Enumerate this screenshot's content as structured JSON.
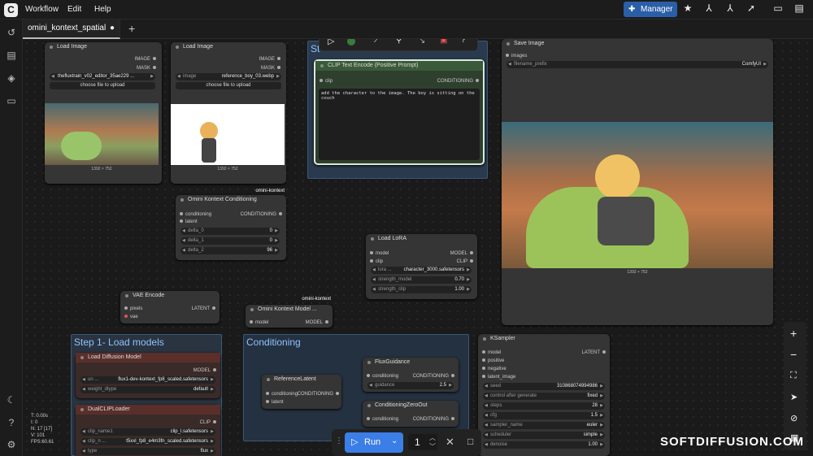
{
  "menu": {
    "items": [
      "Workflow",
      "Edit",
      "Help"
    ],
    "manager": "Manager"
  },
  "tab": {
    "name": "omini_kontext_spatial",
    "dot": "●"
  },
  "stats": {
    "t": "T: 0.00s",
    "i": "I: 0",
    "n": "N: 17 [17]",
    "v": "V: 101",
    "fps": "FPS:60.61"
  },
  "nodes": {
    "load1": {
      "title": "Load Image",
      "out1": "IMAGE",
      "out2": "MASK",
      "file": "thefluxtrain_v02_editor_35ae229 ...",
      "upload": "choose file to upload",
      "dims": "1392 × 752"
    },
    "load2": {
      "title": "Load Image",
      "out1": "IMAGE",
      "out2": "MASK",
      "label": "image",
      "file": "reference_boy_03.webp",
      "upload": "choose file to upload",
      "dims": "1392 × 752",
      "badge": "omini-kontext"
    },
    "clip": {
      "title": "CLIP Text Encode (Positive Prompt)",
      "in": "clip",
      "out": "CONDITIONING",
      "text": "add the character to the image. The boy is sitting on the couch",
      "group_letter": "St"
    },
    "save": {
      "title": "Save Image",
      "in": "images",
      "label": "filename_prefix",
      "value": "ComfyUI",
      "dims": "1392 × 752"
    },
    "okc": {
      "title": "Omini Kontext Conditioning",
      "in1": "conditioning",
      "in2": "latent",
      "out": "CONDITIONING",
      "w": [
        {
          "l": "delta_0",
          "v": "0"
        },
        {
          "l": "delta_1",
          "v": "0"
        },
        {
          "l": "delta_2",
          "v": "96"
        }
      ]
    },
    "lora": {
      "title": "Load LoRA",
      "in1": "model",
      "in2": "clip",
      "out1": "MODEL",
      "out2": "CLIP",
      "w": [
        {
          "l": "lora ...",
          "v": "character_3000.safetensors"
        },
        {
          "l": "strength_model",
          "v": "0.70"
        },
        {
          "l": "strength_clip",
          "v": "1.00"
        }
      ]
    },
    "vae": {
      "title": "VAE Encode",
      "in1": "pixels",
      "in2": "vae",
      "out": "LATENT"
    },
    "okm": {
      "title": "Omini Kontext Model ...",
      "in": "model",
      "out": "MODEL",
      "badge": "omini-kontext"
    },
    "ks": {
      "title": "KSampler",
      "in": [
        "model",
        "positive",
        "negative",
        "latent_image"
      ],
      "out": "LATENT",
      "w": [
        {
          "l": "seed",
          "v": "310868074994986"
        },
        {
          "l": "control after generate",
          "v": "fixed"
        },
        {
          "l": "steps",
          "v": "28"
        },
        {
          "l": "cfg",
          "v": "1.5"
        },
        {
          "l": "sampler_name",
          "v": "euler"
        },
        {
          "l": "scheduler",
          "v": "simple"
        },
        {
          "l": "denoise",
          "v": "1.00"
        }
      ]
    },
    "ref": {
      "title": "ReferenceLatent",
      "in1": "conditioning",
      "in2": "latent",
      "out": "CONDITIONING"
    },
    "fg": {
      "title": "FluxGuidance",
      "in": "conditioning",
      "out": "CONDITIONING",
      "w": {
        "l": "guidance",
        "v": "2.5"
      }
    },
    "czo": {
      "title": "ConditioningZeroOut",
      "in": "conditioning",
      "out": "CONDITIONING"
    },
    "ldm": {
      "title": "Load Diffusion Model",
      "out": "MODEL",
      "w": [
        {
          "l": "un ...",
          "v": "flux1-dev-kontext_fp8_scaled.safetensors"
        },
        {
          "l": "weight_dtype",
          "v": "default"
        }
      ]
    },
    "dcl": {
      "title": "DualCLIPLoader",
      "out": "CLIP",
      "w": [
        {
          "l": "clip_name1",
          "v": "clip_l.safetensors"
        },
        {
          "l": "clip_n ...",
          "v": "t5xxl_fp8_e4m3fn_scaled.safetensors"
        },
        {
          "l": "type",
          "v": "flux"
        }
      ]
    }
  },
  "groups": {
    "step1": "Step 1- Load models",
    "cond": "Conditioning"
  },
  "run": {
    "label": "Run",
    "count": "1"
  },
  "watermark": "SOFTDIFFUSION.COM"
}
